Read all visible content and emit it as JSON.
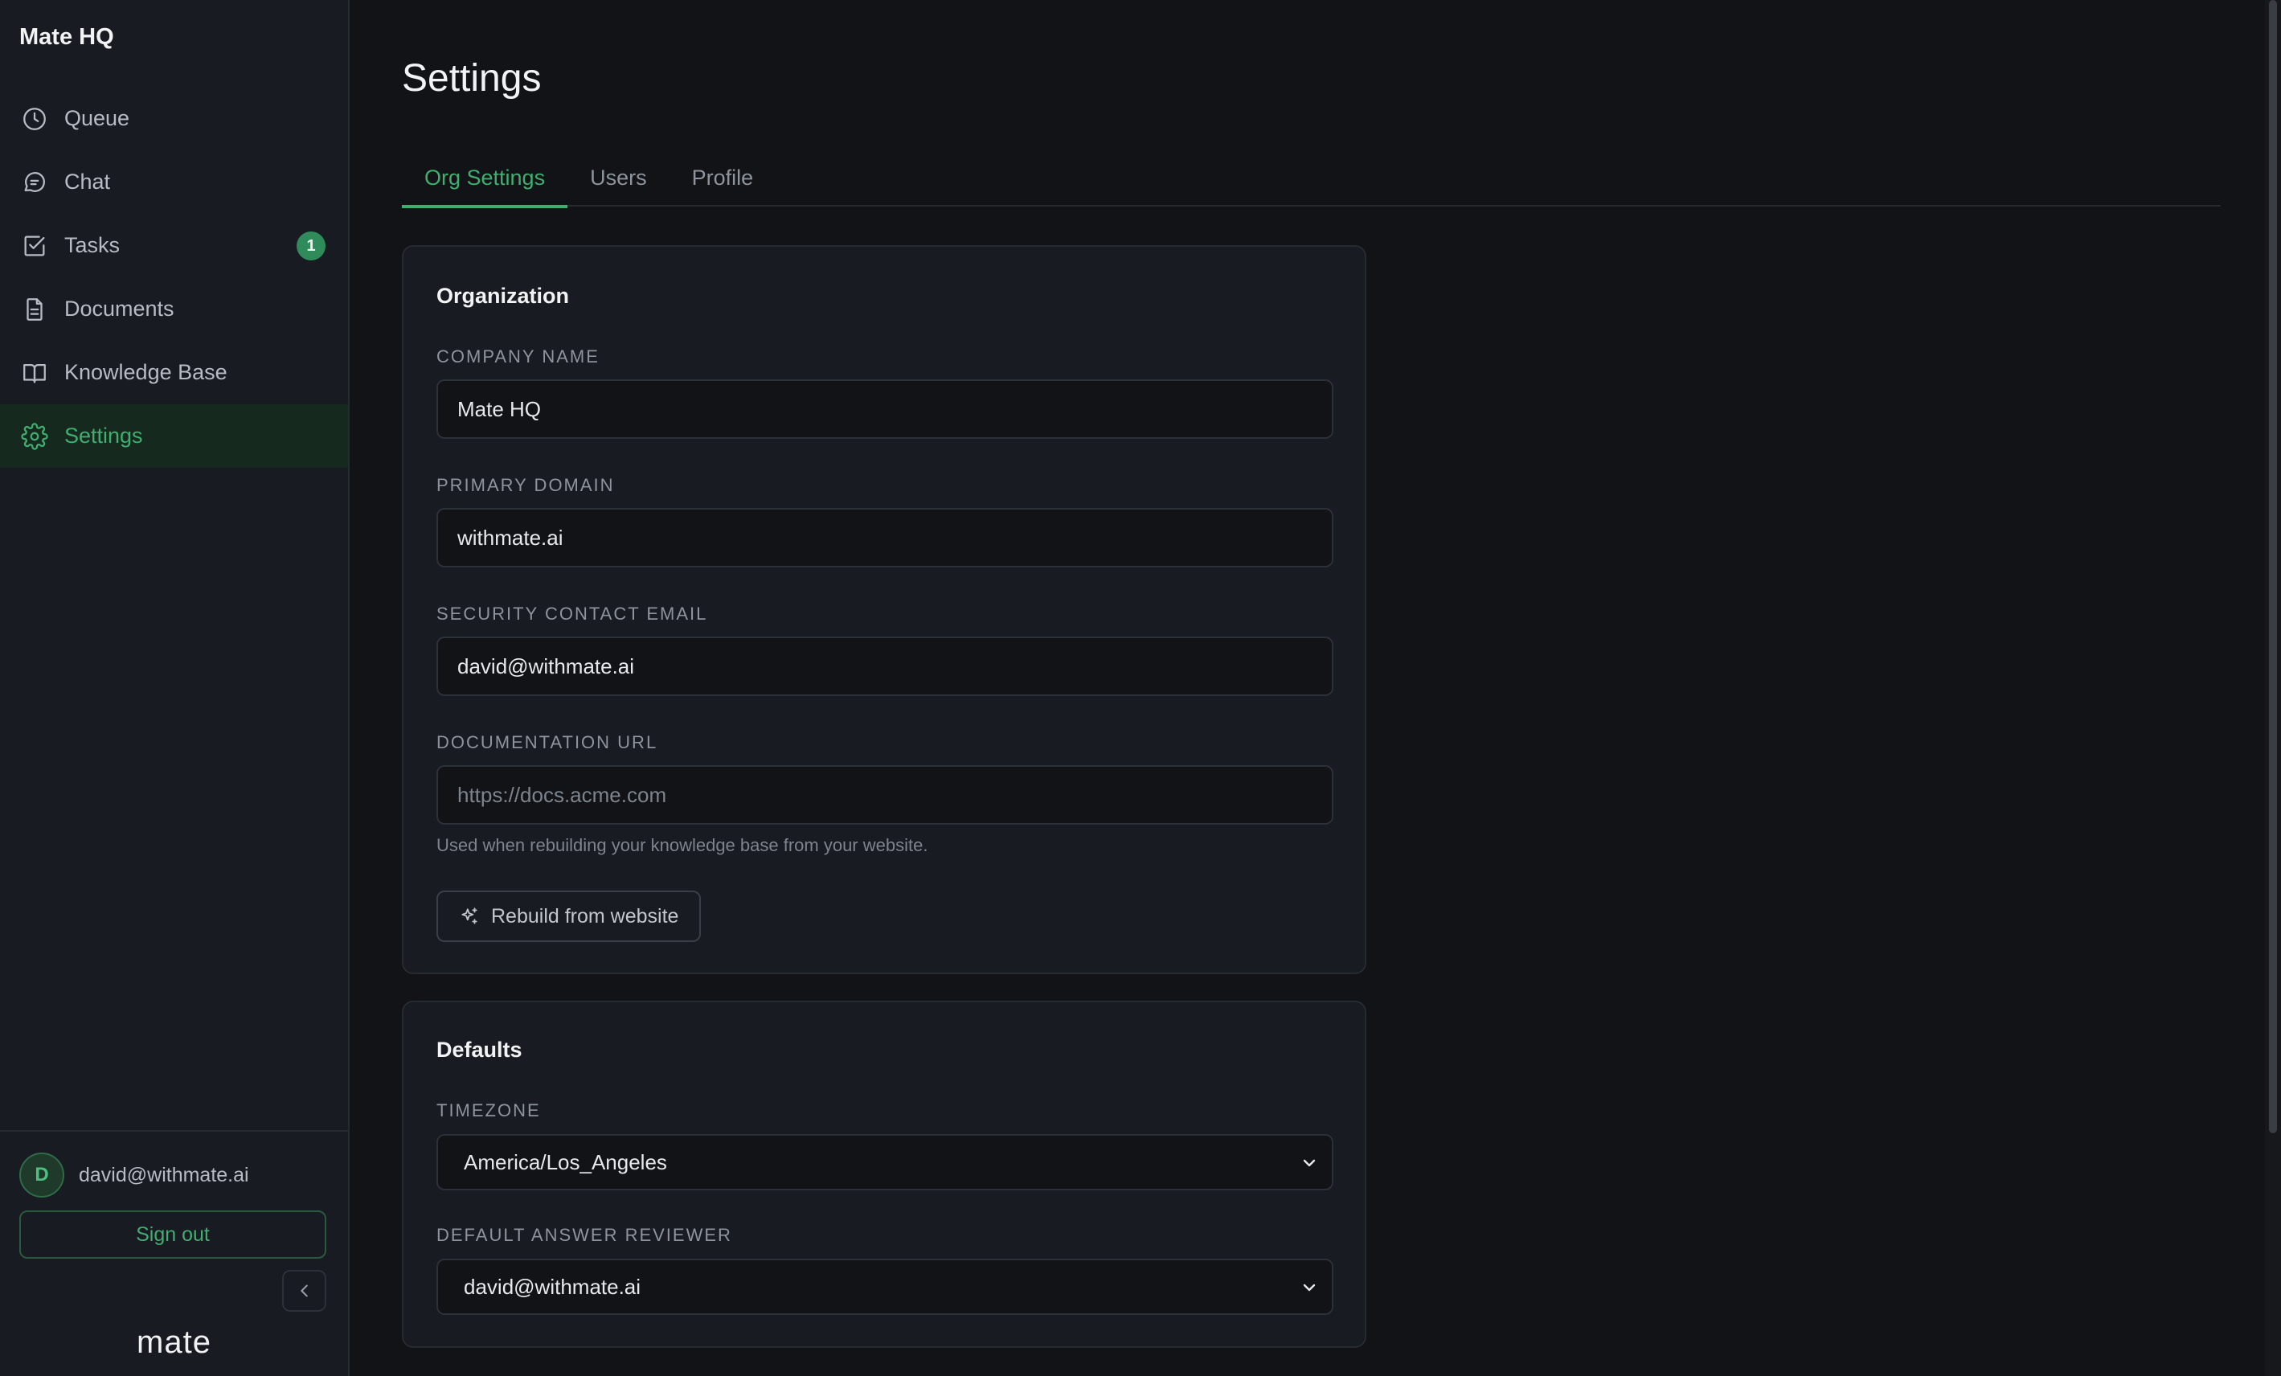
{
  "sidebar": {
    "org_name": "Mate HQ",
    "nav": [
      {
        "label": "Queue",
        "icon": "clock-icon"
      },
      {
        "label": "Chat",
        "icon": "chat-bubble-icon"
      },
      {
        "label": "Tasks",
        "icon": "checkbox-icon",
        "badge": "1"
      },
      {
        "label": "Documents",
        "icon": "document-icon"
      },
      {
        "label": "Knowledge Base",
        "icon": "book-icon"
      },
      {
        "label": "Settings",
        "icon": "gear-icon",
        "active": true
      }
    ],
    "user": {
      "initial": "D",
      "email": "david@withmate.ai"
    },
    "sign_out_label": "Sign out",
    "logo_text": "mate"
  },
  "page": {
    "title": "Settings",
    "tabs": [
      {
        "label": "Org Settings",
        "active": true
      },
      {
        "label": "Users"
      },
      {
        "label": "Profile"
      }
    ]
  },
  "organization": {
    "title": "Organization",
    "company_name": {
      "label": "COMPANY NAME",
      "value": "Mate HQ"
    },
    "primary_domain": {
      "label": "PRIMARY DOMAIN",
      "value": "withmate.ai"
    },
    "security_email": {
      "label": "SECURITY CONTACT EMAIL",
      "value": "david@withmate.ai"
    },
    "docs_url": {
      "label": "DOCUMENTATION URL",
      "value": "",
      "placeholder": "https://docs.acme.com",
      "helper": "Used when rebuilding your knowledge base from your website."
    },
    "rebuild_label": "Rebuild from website"
  },
  "defaults": {
    "title": "Defaults",
    "timezone": {
      "label": "TIMEZONE",
      "value": "America/Los_Angeles"
    },
    "reviewer": {
      "label": "DEFAULT ANSWER REVIEWER",
      "value": "david@withmate.ai"
    }
  },
  "colors": {
    "accent": "#3fae6f",
    "background": "#111317",
    "sidebar": "#181b21",
    "border": "#262a31"
  }
}
